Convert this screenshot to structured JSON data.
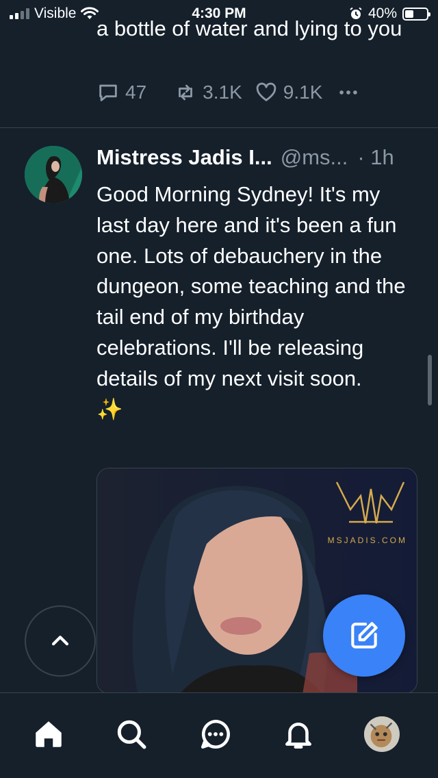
{
  "status_bar": {
    "carrier": "Visible",
    "time": "4:30 PM",
    "battery_percent": "40%",
    "battery_level": 0.4
  },
  "previous_tweet": {
    "text": "a bottle of water and lying to you",
    "replies": "47",
    "retweets": "3.1K",
    "likes": "9.1K"
  },
  "tweet": {
    "display_name": "Mistress Jadis I...",
    "handle": "@ms...",
    "time": "· 1h",
    "text": "Good Morning Sydney! It's my last day here and it's been a fun one. Lots of debauchery in the dungeon, some teaching and the tail end of my birthday celebrations. I'll be releasing details of my next visit soon.",
    "emoji": "✨",
    "media_watermark": "MSJADIS.COM"
  },
  "colors": {
    "background": "#15202b",
    "muted": "#8b98a5",
    "accent": "#3a82f7",
    "divider": "#38444d"
  },
  "icons": {
    "reply": "reply-icon",
    "retweet": "retweet-icon",
    "like": "heart-icon",
    "more": "more-icon",
    "scroll_top": "chevron-up-icon",
    "compose": "compose-icon",
    "nav": [
      "home-icon",
      "search-icon",
      "messages-icon",
      "notifications-icon",
      "profile-avatar"
    ]
  }
}
